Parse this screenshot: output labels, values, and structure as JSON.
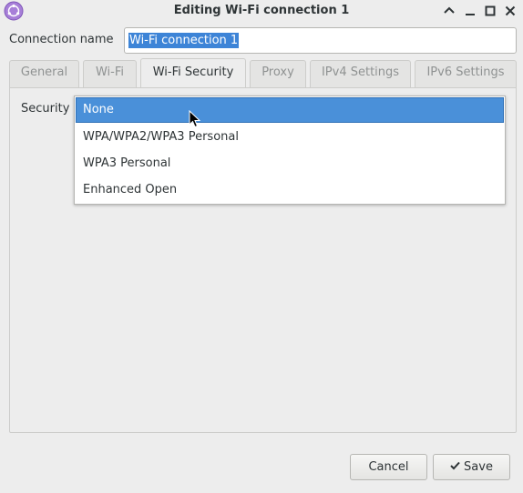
{
  "window": {
    "title": "Editing Wi-Fi connection 1"
  },
  "connection": {
    "label": "Connection name",
    "value": "Wi-Fi connection 1"
  },
  "tabs": [
    {
      "label": "General"
    },
    {
      "label": "Wi-Fi"
    },
    {
      "label": "Wi-Fi Security"
    },
    {
      "label": "Proxy"
    },
    {
      "label": "IPv4 Settings"
    },
    {
      "label": "IPv6 Settings"
    }
  ],
  "active_tab": "Wi-Fi Security",
  "security": {
    "label": "Security",
    "options": [
      "None",
      "WPA/WPA2/WPA3 Personal",
      "WPA3 Personal",
      "Enhanced Open"
    ],
    "selected": "None"
  },
  "buttons": {
    "cancel": "Cancel",
    "save": "Save"
  },
  "icons": {
    "app": "network-manager-icon",
    "save": "checkmark-icon"
  },
  "colors": {
    "selection": "#4a90d9",
    "background": "#ededed"
  }
}
